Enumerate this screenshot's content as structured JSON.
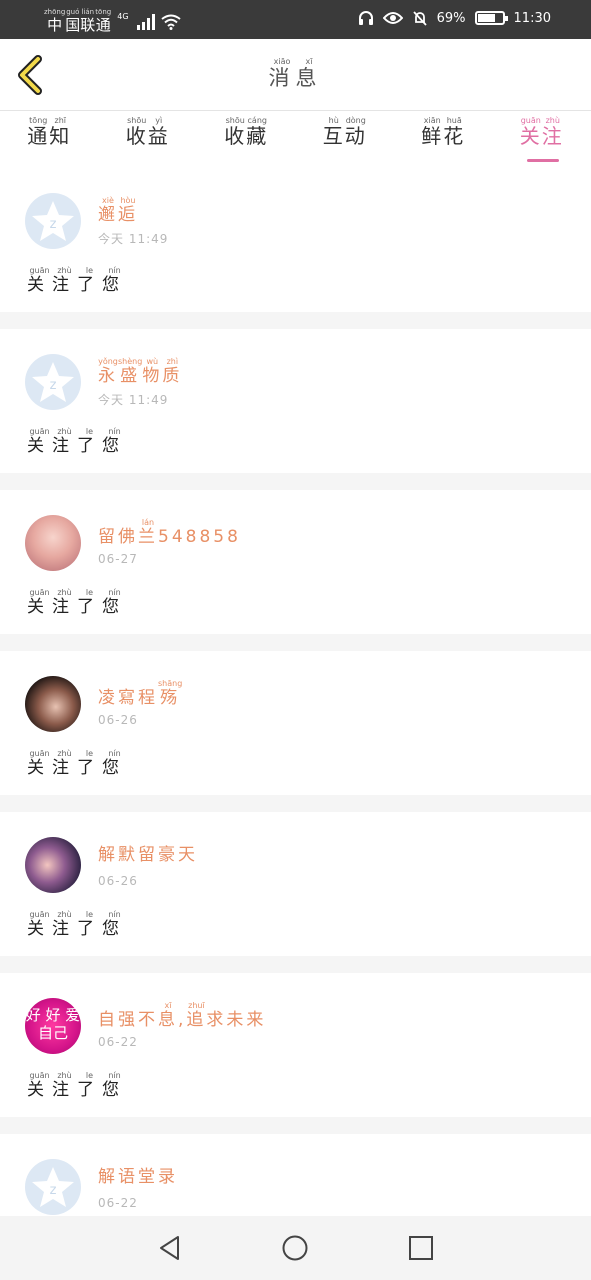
{
  "status_bar": {
    "carrier": [
      {
        "char": "中",
        "pinyin": "zhōng"
      },
      {
        "char": "国",
        "pinyin": "guó"
      },
      {
        "char": "联",
        "pinyin": "lián"
      },
      {
        "char": "通",
        "pinyin": "tōng"
      }
    ],
    "network": "4G",
    "battery": "69%",
    "time": "11:30"
  },
  "header": {
    "title": [
      {
        "char": "消",
        "pinyin": "xiāo"
      },
      {
        "char": "息",
        "pinyin": "xī"
      }
    ]
  },
  "tabs": [
    {
      "chars": [
        {
          "c": "通",
          "p": "tōng"
        },
        {
          "c": "知",
          "p": "zhī"
        }
      ]
    },
    {
      "chars": [
        {
          "c": "收",
          "p": "shōu"
        },
        {
          "c": "益",
          "p": "yì"
        }
      ]
    },
    {
      "chars": [
        {
          "c": "收",
          "p": "shōu"
        },
        {
          "c": "藏",
          "p": "cáng"
        }
      ]
    },
    {
      "chars": [
        {
          "c": "互",
          "p": "hù"
        },
        {
          "c": "动",
          "p": "dòng"
        }
      ]
    },
    {
      "chars": [
        {
          "c": "鲜",
          "p": "xiān"
        },
        {
          "c": "花",
          "p": "huā"
        }
      ]
    },
    {
      "chars": [
        {
          "c": "关",
          "p": "guān"
        },
        {
          "c": "注",
          "p": "zhù"
        }
      ],
      "active": true
    }
  ],
  "notifications": [
    {
      "name": [
        {
          "c": "邂",
          "p": "xiè"
        },
        {
          "c": "逅",
          "p": "hòu"
        }
      ],
      "time": "今天 11:49",
      "avatar": "default"
    },
    {
      "name": [
        {
          "c": "永",
          "p": "yǒng"
        },
        {
          "c": "盛",
          "p": "shèng"
        },
        {
          "c": "物",
          "p": "wù"
        },
        {
          "c": "质",
          "p": "zhì"
        }
      ],
      "time": "今天 11:49",
      "avatar": "default"
    },
    {
      "name": [
        {
          "c": "留",
          "p": ""
        },
        {
          "c": "佛",
          "p": ""
        },
        {
          "c": "兰",
          "p": "lán"
        },
        {
          "c": "548858",
          "p": ""
        }
      ],
      "time": "06-27",
      "avatar": "photo1"
    },
    {
      "name": [
        {
          "c": "凌",
          "p": ""
        },
        {
          "c": "寫",
          "p": ""
        },
        {
          "c": "程",
          "p": ""
        },
        {
          "c": "殇",
          "p": "shāng"
        }
      ],
      "time": "06-26",
      "avatar": "photo2"
    },
    {
      "name": [
        {
          "c": "解",
          "p": ""
        },
        {
          "c": "默",
          "p": ""
        },
        {
          "c": "留",
          "p": ""
        },
        {
          "c": "豪",
          "p": ""
        },
        {
          "c": "天",
          "p": ""
        }
      ],
      "time": "06-26",
      "avatar": "photo3"
    },
    {
      "name": [
        {
          "c": "自",
          "p": ""
        },
        {
          "c": "强",
          "p": ""
        },
        {
          "c": "不",
          "p": ""
        },
        {
          "c": "息",
          "p": "xī"
        },
        {
          "c": ",",
          "p": ""
        },
        {
          "c": "追",
          "p": "zhuī"
        },
        {
          "c": "求",
          "p": ""
        },
        {
          "c": "未",
          "p": ""
        },
        {
          "c": "来",
          "p": ""
        }
      ],
      "time": "06-22",
      "avatar": "photo4",
      "avatar_text": "好 好 爱 自己"
    },
    {
      "name": [
        {
          "c": "解",
          "p": ""
        },
        {
          "c": "语",
          "p": ""
        },
        {
          "c": "堂",
          "p": ""
        },
        {
          "c": "录",
          "p": ""
        }
      ],
      "time": "06-22",
      "avatar": "default"
    }
  ],
  "message_text": [
    {
      "c": "关",
      "p": "guān"
    },
    {
      "c": "注",
      "p": "zhù"
    },
    {
      "c": "了",
      "p": "le"
    },
    {
      "c": "您",
      "p": "nín"
    }
  ],
  "colors": {
    "accent": "#e06fa3",
    "name": "#e89066",
    "status_bar": "#3a3a3a",
    "back_arrow": "#f2d94a"
  },
  "icons": {
    "back": "chevron-left-icon",
    "nav_back": "triangle-back-icon",
    "nav_home": "circle-home-icon",
    "nav_recents": "square-recents-icon"
  }
}
